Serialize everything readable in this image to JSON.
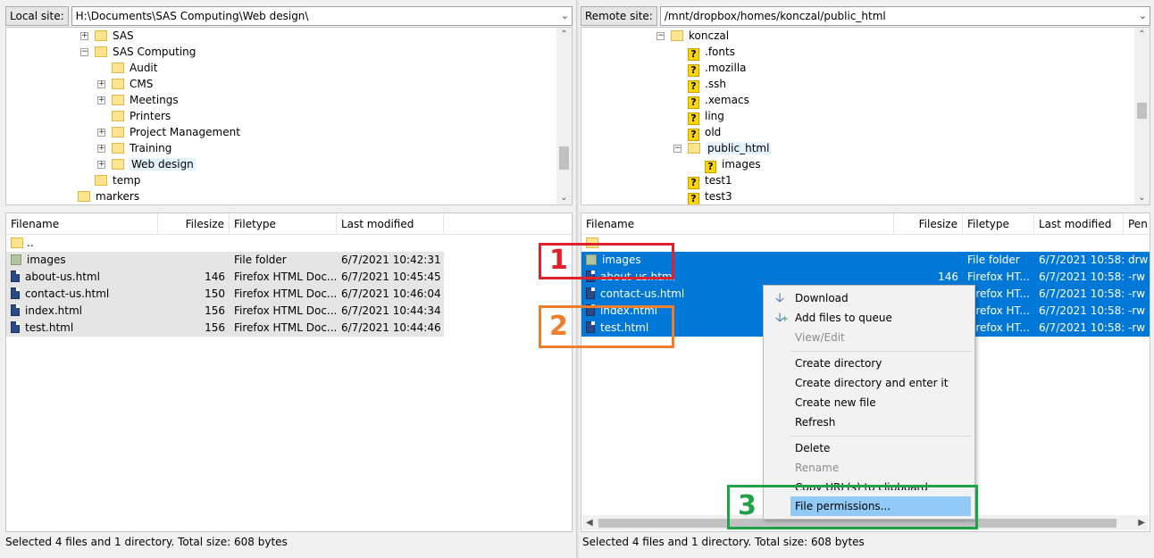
{
  "colors": {
    "selection": "#0078d7",
    "menu_hover": "#91c9f7",
    "annot_1": "#e0202a",
    "annot_2": "#f07d2a",
    "annot_3": "#21a24a"
  },
  "local": {
    "site_label": "Local site:",
    "path": "H:\\Documents\\SAS Computing\\Web design\\",
    "tree": [
      {
        "label": "SAS",
        "icon": "folder-icon"
      },
      {
        "label": "SAS Computing",
        "icon": "folder-icon"
      },
      {
        "label": "Audit",
        "icon": "folder-icon"
      },
      {
        "label": "CMS",
        "icon": "folder-icon"
      },
      {
        "label": "Meetings",
        "icon": "folder-icon"
      },
      {
        "label": "Printers",
        "icon": "folder-icon"
      },
      {
        "label": "Project Management",
        "icon": "folder-icon"
      },
      {
        "label": "Training",
        "icon": "folder-icon"
      },
      {
        "label": "Web design",
        "icon": "folder-icon"
      },
      {
        "label": "temp",
        "icon": "folder-icon"
      },
      {
        "label": "markers",
        "icon": "folder-icon"
      }
    ],
    "headers": {
      "filename": "Filename",
      "filesize": "Filesize",
      "filetype": "Filetype",
      "modified": "Last modified"
    },
    "files": [
      {
        "name": "..",
        "size": "",
        "type": "",
        "modified": ""
      },
      {
        "name": "images",
        "size": "",
        "type": "File folder",
        "modified": "6/7/2021 10:42:31 ..."
      },
      {
        "name": "about-us.html",
        "size": "146",
        "type": "Firefox HTML Doc...",
        "modified": "6/7/2021 10:45:45 ..."
      },
      {
        "name": "contact-us.html",
        "size": "150",
        "type": "Firefox HTML Doc...",
        "modified": "6/7/2021 10:46:04 ..."
      },
      {
        "name": "index.html",
        "size": "156",
        "type": "Firefox HTML Doc...",
        "modified": "6/7/2021 10:44:34 ..."
      },
      {
        "name": "test.html",
        "size": "156",
        "type": "Firefox HTML Doc...",
        "modified": "6/7/2021 10:44:46 ..."
      }
    ],
    "status": "Selected 4 files and 1 directory. Total size: 608 bytes"
  },
  "remote": {
    "site_label": "Remote site:",
    "path": "/mnt/dropbox/homes/konczal/public_html",
    "tree": [
      {
        "label": "konczal",
        "icon": "folder-icon"
      },
      {
        "label": ".fonts",
        "icon": "question-icon"
      },
      {
        "label": ".mozilla",
        "icon": "question-icon"
      },
      {
        "label": ".ssh",
        "icon": "question-icon"
      },
      {
        "label": ".xemacs",
        "icon": "question-icon"
      },
      {
        "label": "ling",
        "icon": "question-icon"
      },
      {
        "label": "old",
        "icon": "question-icon"
      },
      {
        "label": "public_html",
        "icon": "folder-icon"
      },
      {
        "label": "images",
        "icon": "question-icon"
      },
      {
        "label": "test1",
        "icon": "question-icon"
      },
      {
        "label": "test3",
        "icon": "question-icon"
      }
    ],
    "headers": {
      "filename": "Filename",
      "filesize": "Filesize",
      "filetype": "Filetype",
      "modified": "Last modified",
      "permissions": "Pen"
    },
    "files": [
      {
        "name": "",
        "size": "",
        "type": "",
        "modified": "",
        "perm": ""
      },
      {
        "name": "images",
        "size": "",
        "type": "File folder",
        "modified": "6/7/2021 10:58:...",
        "perm": "drw"
      },
      {
        "name": "about-us.html",
        "size": "146",
        "type": "Firefox HT...",
        "modified": "6/7/2021 10:58:...",
        "perm": "-rw"
      },
      {
        "name": "contact-us.html",
        "size": "",
        "type": "Firefox HT...",
        "modified": "6/7/2021 10:58:...",
        "perm": "-rw"
      },
      {
        "name": "index.html",
        "size": "",
        "type": "Firefox HT...",
        "modified": "6/7/2021 10:58:...",
        "perm": "-rw"
      },
      {
        "name": "test.html",
        "size": "",
        "type": "Firefox HT...",
        "modified": "6/7/2021 10:58:...",
        "perm": "-rw"
      }
    ],
    "status": "Selected 4 files and 1 directory. Total size: 608 bytes"
  },
  "context_menu": {
    "download": "Download",
    "add_to_queue": "Add files to queue",
    "view_edit": "View/Edit",
    "create_directory": "Create directory",
    "create_directory_enter": "Create directory and enter it",
    "create_new_file": "Create new file",
    "refresh": "Refresh",
    "delete": "Delete",
    "rename": "Rename",
    "copy_url": "Copy URL(s) to clipboard",
    "file_permissions": "File permissions..."
  },
  "annotations": {
    "one": "1",
    "two": "2",
    "three": "3"
  }
}
